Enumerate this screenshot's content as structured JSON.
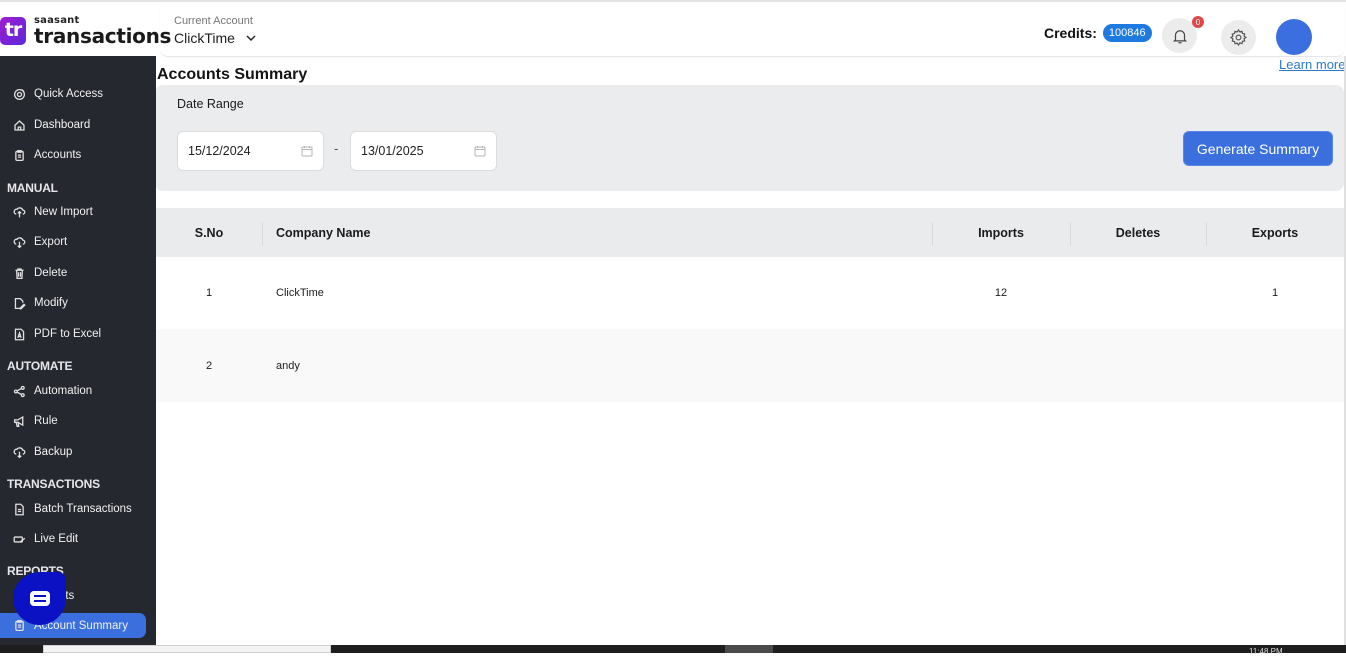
{
  "app": {
    "logo_mark": "tr",
    "logo_small": "saasant",
    "logo_big": "transactions"
  },
  "header": {
    "account_label": "Current Account",
    "account_value": "ClickTime",
    "credits_label": "Credits:",
    "credits_value": "100846",
    "notification_count": "0",
    "learn_more": "Learn more"
  },
  "sidebar": {
    "items_top": [
      {
        "label": "Quick Access",
        "icon": "target-icon"
      },
      {
        "label": "Dashboard",
        "icon": "home-icon"
      },
      {
        "label": "Accounts",
        "icon": "clipboard-icon"
      }
    ],
    "sections": [
      {
        "title": "MANUAL",
        "items": [
          {
            "label": "New Import",
            "icon": "cloud-upload-icon"
          },
          {
            "label": "Export",
            "icon": "cloud-download-icon"
          },
          {
            "label": "Delete",
            "icon": "trash-icon"
          },
          {
            "label": "Modify",
            "icon": "file-edit-icon"
          },
          {
            "label": "PDF to Excel",
            "icon": "pdf-icon"
          }
        ]
      },
      {
        "title": "AUTOMATE",
        "items": [
          {
            "label": "Automation",
            "icon": "share-nodes-icon"
          },
          {
            "label": "Rule",
            "icon": "megaphone-icon"
          },
          {
            "label": "Backup",
            "icon": "cloud-download-icon"
          }
        ]
      },
      {
        "title": "TRANSACTIONS",
        "items": [
          {
            "label": "Batch Transactions",
            "icon": "document-icon"
          },
          {
            "label": "Live Edit",
            "icon": "pencil-card-icon"
          }
        ]
      },
      {
        "title": "REPORTS",
        "items": [
          {
            "label": "Reports",
            "icon": "document-icon"
          },
          {
            "label": "Account Summary",
            "icon": "clipboard-icon",
            "active": true
          }
        ]
      }
    ]
  },
  "main": {
    "title": "Accounts Summary",
    "date_range_label": "Date Range",
    "date_from": "15/12/2024",
    "date_to": "13/01/2025",
    "date_separator": "-",
    "generate_button": "Generate Summary",
    "table": {
      "columns": [
        "S.No",
        "Company Name",
        "Imports",
        "Deletes",
        "Exports"
      ],
      "rows": [
        {
          "sno": "1",
          "company": "ClickTime",
          "imports": "12",
          "deletes": "",
          "exports": "1"
        },
        {
          "sno": "2",
          "company": "andy",
          "imports": "",
          "deletes": "",
          "exports": ""
        }
      ]
    }
  },
  "taskbar": {
    "clock": "11:48 PM"
  },
  "colors": {
    "accent": "#3a6fdd",
    "sidebar_bg": "#262830",
    "credits_badge": "#1f7ae0",
    "notification_badge": "#e04848",
    "chat_bubble": "#0a12c4"
  }
}
